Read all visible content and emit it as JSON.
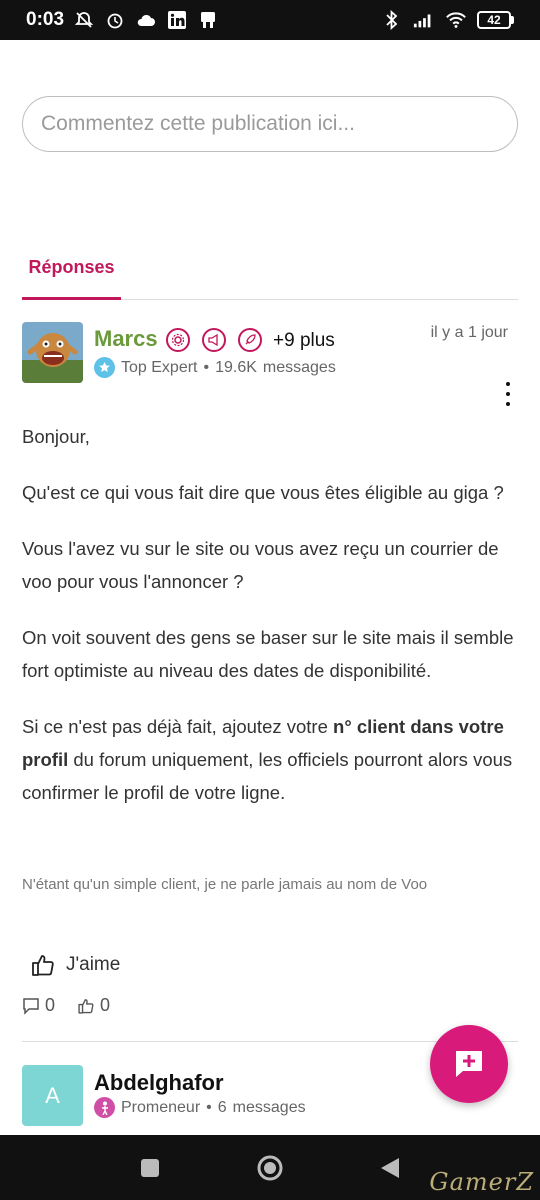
{
  "status_bar": {
    "time": "0:03",
    "battery": "42"
  },
  "comment_box": {
    "placeholder": "Commentez cette publication ici..."
  },
  "tabs": [
    {
      "label": "Réponses"
    }
  ],
  "post": {
    "author": "Marcs",
    "more_badges": "+9 plus",
    "rank": "Top Expert",
    "message_count": "19.6K",
    "messages_label": "messages",
    "separator": "•",
    "timestamp": "il y a 1 jour",
    "paragraphs": [
      "Bonjour,",
      "Qu'est ce qui vous fait dire que vous êtes éligible au giga ?",
      "Vous l'avez vu sur le site ou vous avez reçu un courrier de voo pour vous l'annoncer ?",
      "On voit souvent des gens se baser sur le site mais il semble fort optimiste au niveau des dates de disponibilité."
    ],
    "last_paragraph": {
      "before": "Si ce n'est pas déjà fait, ajoutez votre ",
      "bold": "n° client dans votre profil",
      "after": " du forum uniquement, les officiels pourront alors vous confirmer le profil de votre ligne."
    },
    "signature": "N'étant qu'un simple client, je ne parle jamais au nom de Voo",
    "like_label": "J'aime",
    "comments_count": "0",
    "likes_count": "0"
  },
  "next_post": {
    "avatar_letter": "A",
    "author": "Abdelghafor",
    "rank": "Promeneur",
    "message_count": "6",
    "messages_label": "messages",
    "separator": "•"
  },
  "watermark": "GamerZ",
  "colors": {
    "accent": "#c2185b",
    "fab": "#d81b7a",
    "author_green": "#6a9a3c",
    "avatar2_bg": "#7dd6d3"
  }
}
